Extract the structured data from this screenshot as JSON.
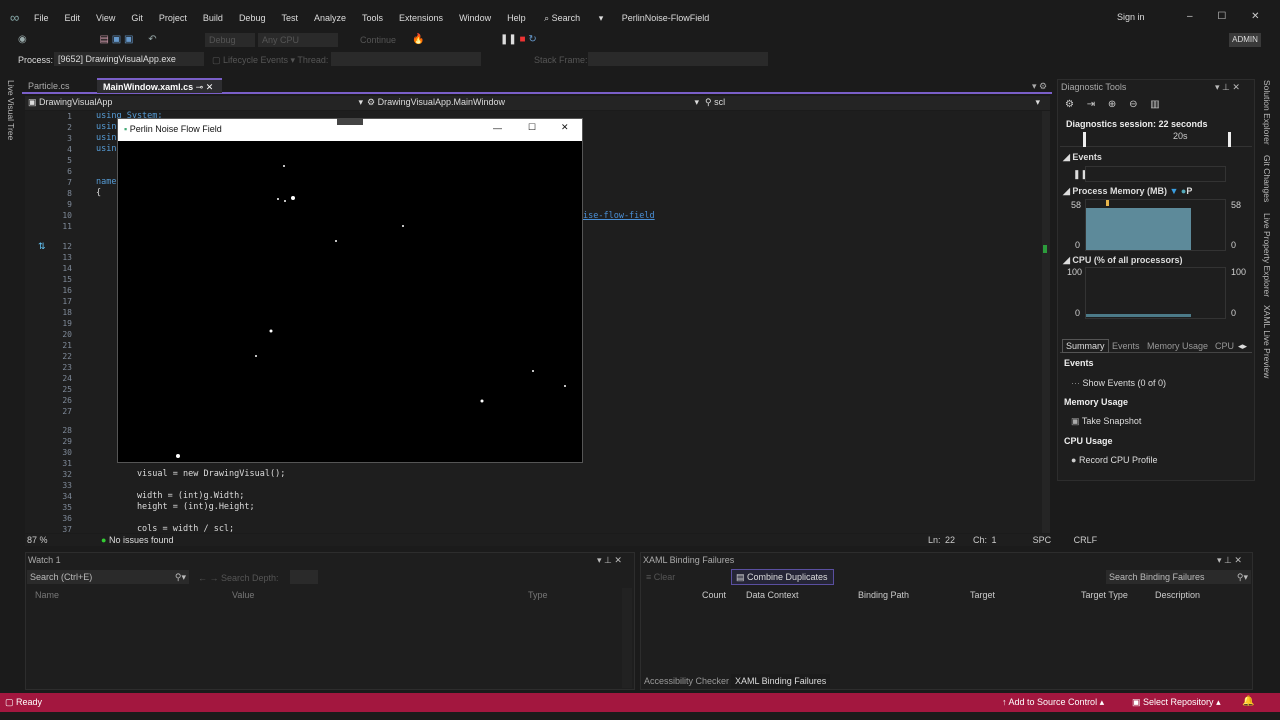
{
  "menu": {
    "items": [
      "File",
      "Edit",
      "View",
      "Git",
      "Project",
      "Build",
      "Debug",
      "Test",
      "Analyze",
      "Tools",
      "Extensions",
      "Window",
      "Help"
    ],
    "search": "Search",
    "solution": "PerlinNoise-FlowField",
    "signin": "Sign in",
    "admin": "ADMIN"
  },
  "toolbar": {
    "config": "Debug",
    "platform": "Any CPU",
    "continue": "Continue"
  },
  "debugbar": {
    "process_label": "Process:",
    "process": "[9652] DrawingVisualApp.exe",
    "lifecycle": "Lifecycle Events",
    "thread": "Thread:",
    "stack_frame": "Stack Frame:"
  },
  "tabs": [
    {
      "label": "Particle.cs"
    },
    {
      "label": "MainWindow.xaml.cs",
      "pin": "⊸"
    }
  ],
  "nav": {
    "project": "DrawingVisualApp",
    "class": "DrawingVisualApp.MainWindow",
    "member": "scl"
  },
  "editor": {
    "lines": [
      {
        "n": "1",
        "code": "using System;"
      },
      {
        "n": "2",
        "code": "usin"
      },
      {
        "n": "3",
        "code": "usin"
      },
      {
        "n": "4",
        "code": "usin"
      },
      {
        "n": "5",
        "code": ""
      },
      {
        "n": "6",
        "code": ""
      },
      {
        "n": "7",
        "code": "namespace"
      },
      {
        "n": "8",
        "code": "{"
      },
      {
        "n": "9",
        "code": ""
      },
      {
        "n": "10",
        "code": ""
      },
      {
        "n": "11",
        "code": ""
      },
      {
        "n": "12",
        "code": ""
      },
      {
        "n": "13",
        "code": ""
      },
      {
        "n": "14",
        "code": ""
      },
      {
        "n": "15",
        "code": ""
      },
      {
        "n": "16",
        "code": ""
      },
      {
        "n": "17",
        "code": ""
      },
      {
        "n": "18",
        "code": ""
      },
      {
        "n": "19",
        "code": ""
      },
      {
        "n": "20",
        "code": ""
      },
      {
        "n": "21",
        "code": ""
      },
      {
        "n": "22",
        "code": ""
      },
      {
        "n": "23",
        "code": ""
      },
      {
        "n": "24",
        "code": ""
      },
      {
        "n": "25",
        "code": ""
      },
      {
        "n": "26",
        "code": ""
      },
      {
        "n": "27",
        "code": ""
      },
      {
        "n": "28",
        "code": ""
      },
      {
        "n": "29",
        "code": ""
      },
      {
        "n": "30",
        "code": ""
      },
      {
        "n": "31",
        "code": ""
      },
      {
        "n": "32",
        "code": "        visual = new DrawingVisual();"
      },
      {
        "n": "33",
        "code": ""
      },
      {
        "n": "34",
        "code": "        width = (int)g.Width;"
      },
      {
        "n": "35",
        "code": "        height = (int)g.Height;"
      },
      {
        "n": "36",
        "code": ""
      },
      {
        "n": "37",
        "code": "        cols = width / scl;"
      }
    ],
    "link_fragment": "ise-flow-field"
  },
  "status_editor": {
    "zoom": "87 %",
    "issues": "No issues found",
    "ln": "Ln: 22",
    "ch": "Ch: 1",
    "spc": "SPC",
    "crlf": "CRLF"
  },
  "app_window": {
    "title": "Perlin Noise Flow Field"
  },
  "diagnostics": {
    "title": "Diagnostic Tools",
    "session": "Diagnostics session: 22 seconds",
    "timeline_tick": "20s",
    "events": "Events",
    "memory": {
      "label": "Process Memory (MB)",
      "max": "58",
      "min": "0",
      "legend": "P",
      "fill": 0.85
    },
    "cpu": {
      "label": "CPU (% of all processors)",
      "max": "100",
      "min": "0"
    },
    "tabs": [
      "Summary",
      "Events",
      "Memory Usage",
      "CPU"
    ],
    "sections": [
      {
        "title": "Events",
        "action": "Show Events (0 of 0)"
      },
      {
        "title": "Memory Usage",
        "action": "Take Snapshot"
      },
      {
        "title": "CPU Usage",
        "action": "Record CPU Profile"
      }
    ]
  },
  "side_tabs": [
    "Solution Explorer",
    "Git Changes",
    "Live Property Explorer",
    "XAML Live Preview"
  ],
  "left_tab": "Live Visual Tree",
  "watch": {
    "title": "Watch 1",
    "search": "Search (Ctrl+E)",
    "depth": "Search Depth:",
    "cols": [
      "Name",
      "Value",
      "Type"
    ]
  },
  "xaml": {
    "title": "XAML Binding Failures",
    "clear": "Clear",
    "combine": "Combine Duplicates",
    "search": "Search Binding Failures",
    "cols": [
      "Count",
      "Data Context",
      "Binding Path",
      "Target",
      "Target Type",
      "Description"
    ],
    "bottom_tabs": [
      "Accessibility Checker",
      "XAML Binding Failures"
    ]
  },
  "statusbar": {
    "ready": "Ready",
    "source": "Add to Source Control",
    "repo": "Select Repository",
    "bg": "#a3173f"
  }
}
